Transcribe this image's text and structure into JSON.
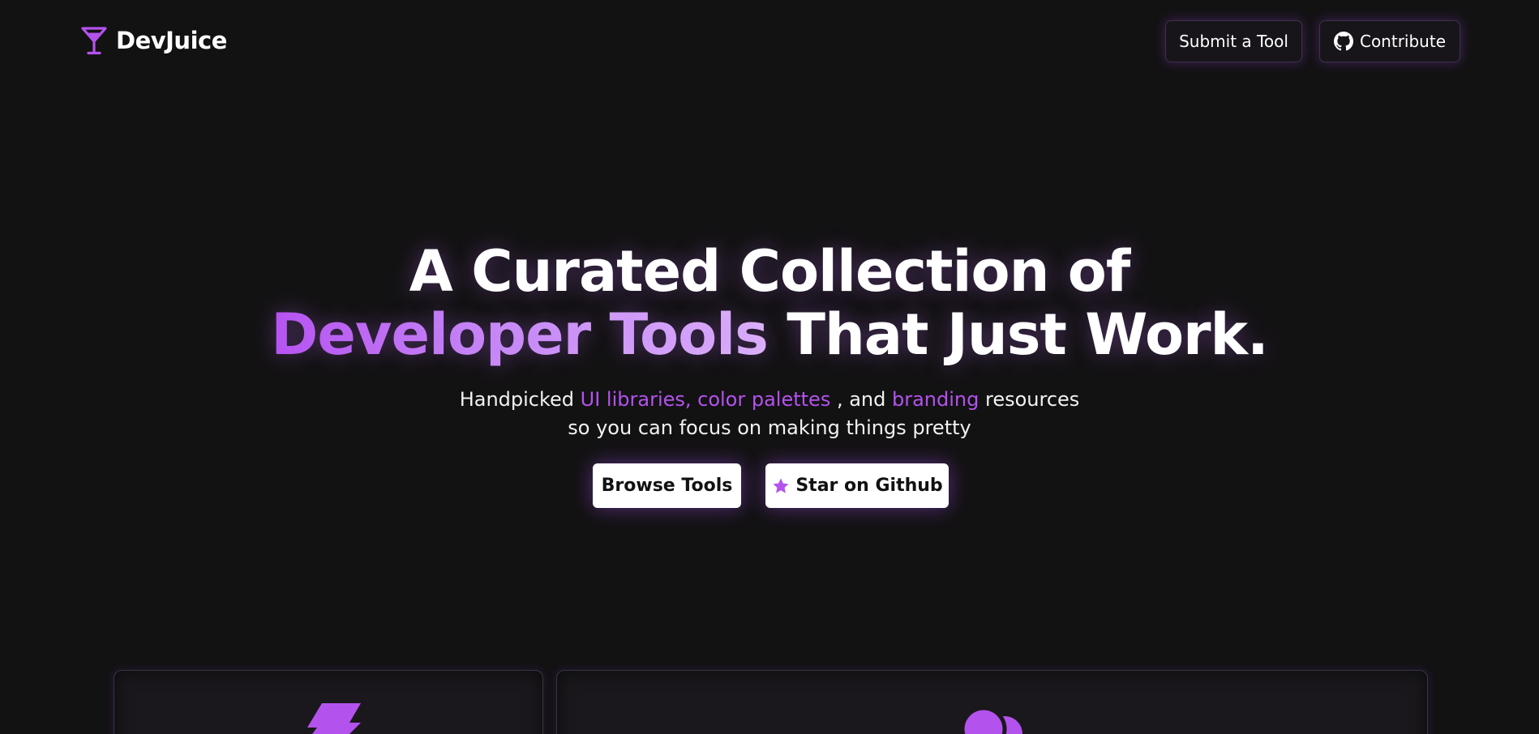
{
  "brand": {
    "name": "DevJuice",
    "icon": "cocktail-glass-icon",
    "accent_color": "#b452ee"
  },
  "nav": {
    "submit_label": "Submit a Tool",
    "contribute_label": "Contribute",
    "contribute_icon": "github-icon"
  },
  "hero": {
    "title_line1": "A Curated Collection of",
    "title_accent": "Developer Tools",
    "title_rest": " That Just Work.",
    "sub_prefix": "Handpicked ",
    "sub_hl1": "UI libraries, color palettes",
    "sub_mid": " , and ",
    "sub_hl2": "branding",
    "sub_suffix": " resources",
    "sub_line2": "so you can focus on making things pretty"
  },
  "cta": {
    "browse_label": "Browse Tools",
    "star_label": "Star on Github",
    "star_icon": "star-icon"
  },
  "cards": [
    {
      "icon": "lightning-bolt-icon"
    },
    {
      "icon": "palette-circles-icon"
    }
  ],
  "colors": {
    "background": "#131213",
    "accent": "#b452ee",
    "button_bg": "#ffffff"
  }
}
